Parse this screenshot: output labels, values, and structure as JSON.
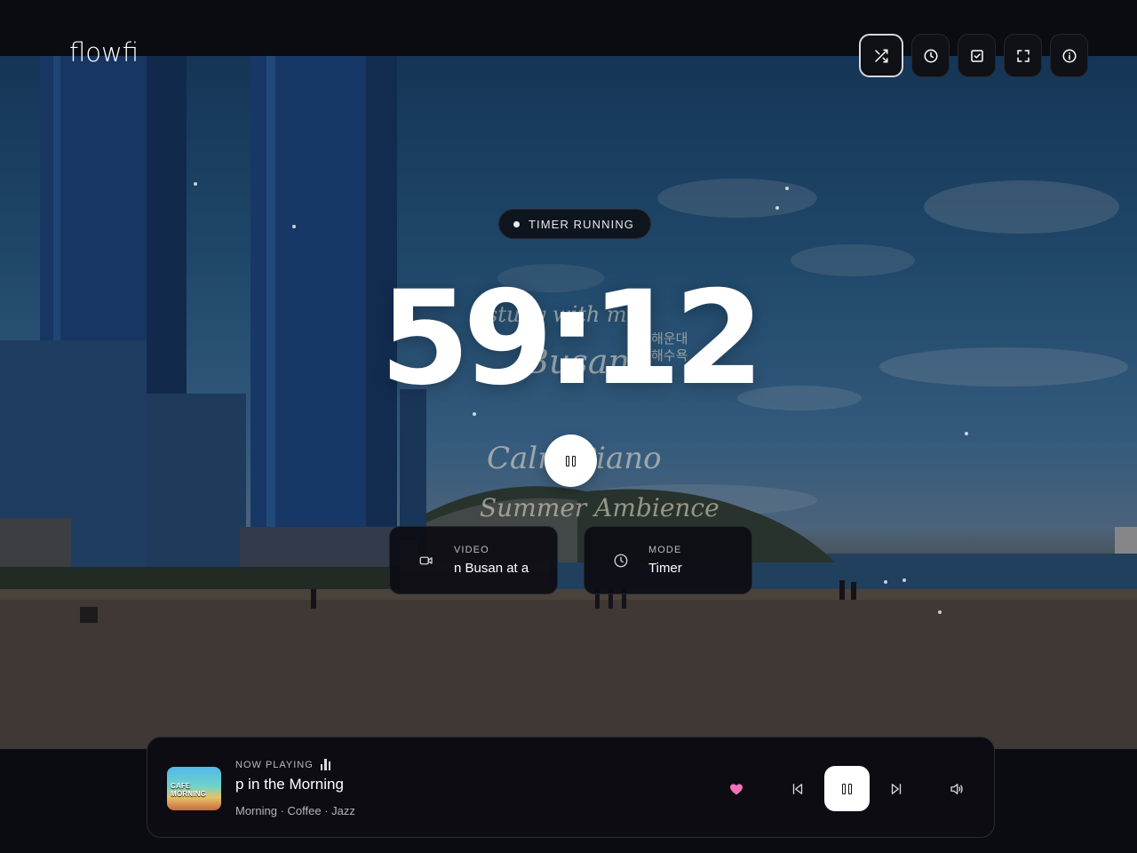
{
  "app": {
    "logo": "flowfi"
  },
  "top_icons": [
    {
      "name": "shuffle-icon",
      "active": true
    },
    {
      "name": "clock-icon"
    },
    {
      "name": "checklist-icon"
    },
    {
      "name": "fullscreen-icon"
    },
    {
      "name": "info-icon"
    }
  ],
  "status": {
    "label": "TIMER RUNNING"
  },
  "timer": {
    "display": "59:12"
  },
  "overlay_script": {
    "line1": "study with me",
    "line2": "Busan",
    "korean": "해운대 해수욕",
    "line3": "Calm Piano",
    "line4": "Summer Ambience"
  },
  "cards": {
    "video": {
      "label": "VIDEO",
      "value": "n Busan at a"
    },
    "mode": {
      "label": "MODE",
      "value": "Timer"
    }
  },
  "player": {
    "now_playing_label": "NOW PLAYING",
    "cover_text": "CAFE MORNING",
    "title": "p in the Morning",
    "tags": "Morning · Coffee · Jazz",
    "liked": true,
    "colors": {
      "heart": "#f472b6"
    }
  }
}
